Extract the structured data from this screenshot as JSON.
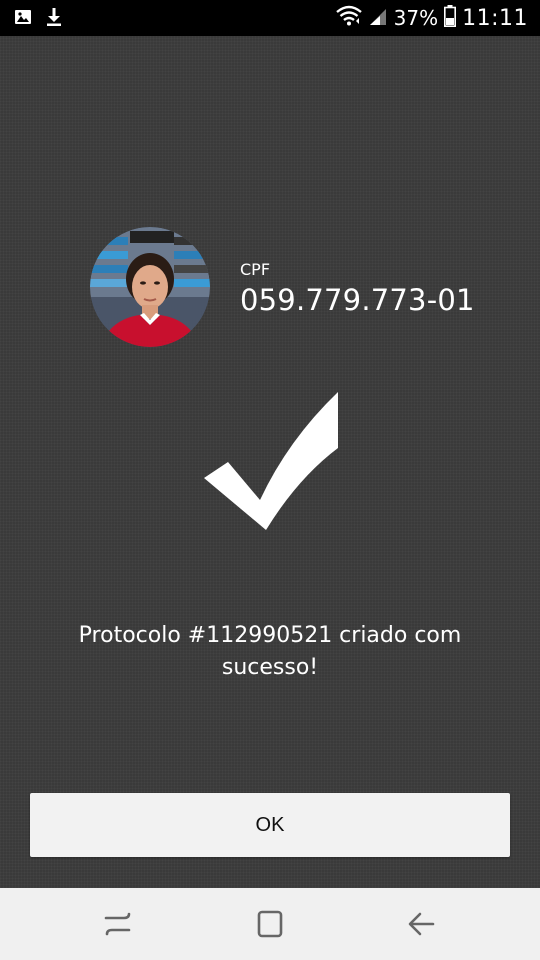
{
  "status_bar": {
    "battery_percent": "37%",
    "time": "11:11"
  },
  "profile": {
    "cpf_label": "CPF",
    "cpf_value": "059.779.773-01"
  },
  "result": {
    "message": "Protocolo #112990521 criado com sucesso!"
  },
  "actions": {
    "ok_label": "OK"
  },
  "icons": {
    "notification_1": "image-icon",
    "notification_2": "download-icon",
    "wifi": "wifi-icon",
    "signal": "signal-icon",
    "battery": "battery-icon",
    "success": "checkmark-icon",
    "nav_recent": "recent-apps-icon",
    "nav_home": "home-icon",
    "nav_back": "back-icon"
  },
  "colors": {
    "background": "#3a3a3a",
    "status_bar": "#000000",
    "button": "#f2f2f2",
    "nav_bar": "#f0f0f0"
  }
}
